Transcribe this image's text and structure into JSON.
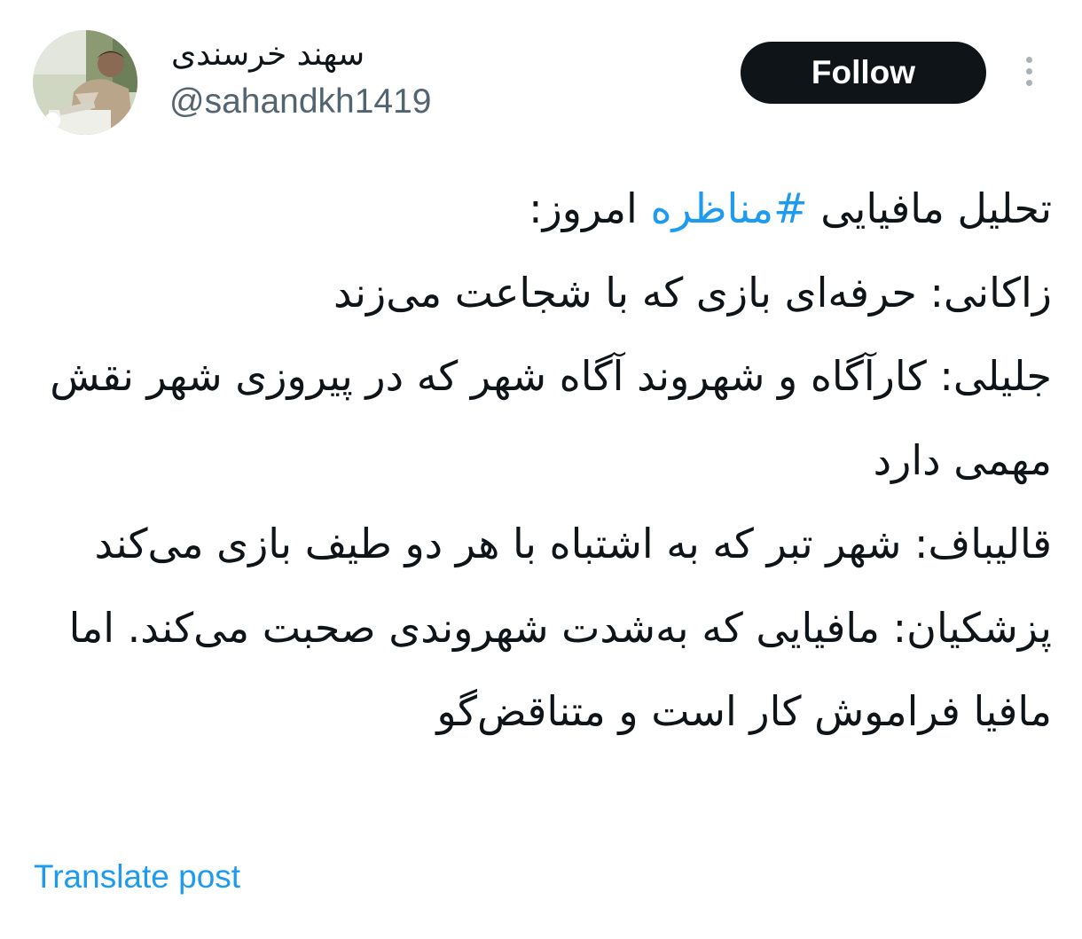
{
  "author": {
    "display_name": "سهند خرسندی",
    "handle": "@sahandkh1419",
    "avatar": "profile-photo"
  },
  "actions": {
    "follow_label": "Follow",
    "more_icon": "more-vertical-icon"
  },
  "tweet": {
    "line1_before": "تحلیل مافیایی ",
    "hashtag": "#مناظره",
    "line1_after": " امروز:",
    "para2": "زاکانی: حرفه‌ای بازی که با شجاعت می‌زند",
    "para3": "جلیلی: کارآگاه و شهروند آگاه شهر که در پیروزی شهر نقش مهمی دارد",
    "para4": "قالیباف: شهر تبر که به اشتباه با هر دو طیف بازی می‌کند",
    "para5": "پزشکیان: مافیایی که به‌شدت شهروندی صحبت می‌کند. اما مافیا فراموش کار است و متناقض‌گو"
  },
  "translate_label": "Translate post",
  "colors": {
    "accent": "#1d9bf0",
    "text": "#0f1419",
    "secondary": "#536471",
    "button_bg": "#0f1419"
  }
}
